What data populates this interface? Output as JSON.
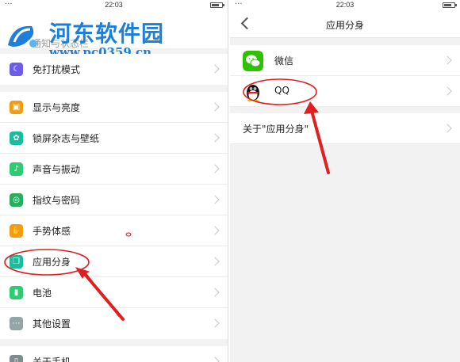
{
  "watermark": {
    "title": "河东软件园",
    "url": "www.pc0359.cn"
  },
  "left_screen": {
    "status": {
      "dots": "···",
      "time": "22:03"
    },
    "partial_row_label": "通知与状态栏",
    "groups": [
      {
        "items": [
          {
            "label": "免打扰模式",
            "icon": "moon-icon",
            "color": "#6c5ce7"
          }
        ]
      },
      {
        "items": [
          {
            "label": "显示与亮度",
            "icon": "display-icon",
            "color": "#f39c12"
          },
          {
            "label": "锁屏杂志与壁纸",
            "icon": "wallpaper-icon",
            "color": "#1abc9c"
          },
          {
            "label": "声音与振动",
            "icon": "sound-icon",
            "color": "#2ecc71"
          },
          {
            "label": "指纹与密码",
            "icon": "fingerprint-icon",
            "color": "#27ae60"
          },
          {
            "label": "手势体感",
            "icon": "gesture-icon",
            "color": "#f39c12"
          },
          {
            "label": "应用分身",
            "icon": "app-clone-icon",
            "color": "#1abc9c"
          },
          {
            "label": "电池",
            "icon": "battery-icon",
            "color": "#2ecc71"
          },
          {
            "label": "其他设置",
            "icon": "more-icon",
            "color": "#95a5a6"
          }
        ]
      },
      {
        "items": [
          {
            "label": "关于手机",
            "icon": "phone-icon",
            "color": "#7f8c8d"
          }
        ]
      }
    ]
  },
  "right_screen": {
    "status": {
      "dots": "···",
      "time": "22:03"
    },
    "nav_title": "应用分身",
    "apps": [
      {
        "label": "微信",
        "icon": "wechat-icon",
        "color": "#2dc100"
      },
      {
        "label": "QQ",
        "icon": "qq-icon",
        "color": "#111111"
      }
    ],
    "about_label": "关于\"应用分身\""
  },
  "annotation_color": "#e02020"
}
